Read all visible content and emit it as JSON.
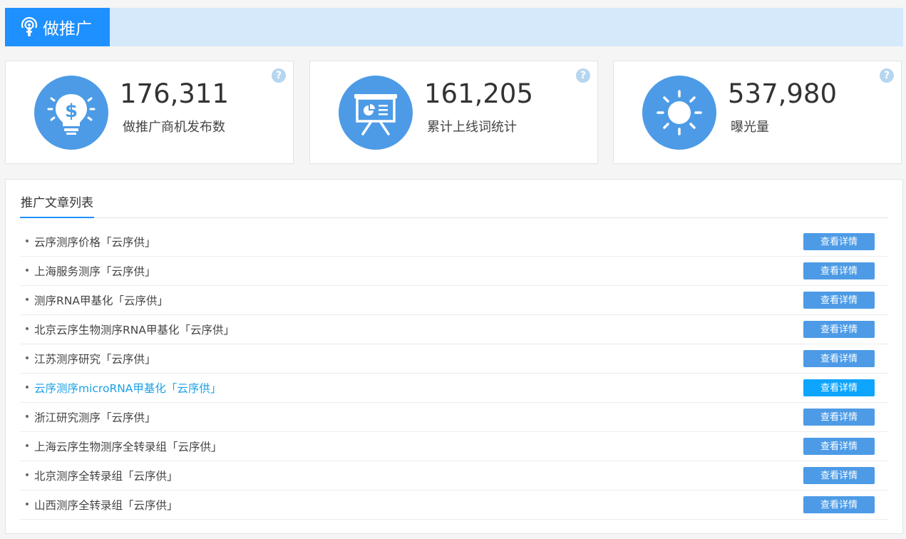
{
  "header": {
    "title": "做推广"
  },
  "stats": [
    {
      "value": "176,311",
      "label": "做推广商机发布数",
      "icon": "money-bulb-icon"
    },
    {
      "value": "161,205",
      "label": "累计上线词统计",
      "icon": "presentation-board-icon"
    },
    {
      "value": "537,980",
      "label": "曝光量",
      "icon": "sun-icon"
    }
  ],
  "help_glyph": "?",
  "list": {
    "tab_label": "推广文章列表",
    "button_label": "查看详情",
    "highlight_color": "#1aa0e6",
    "items": [
      "云序测序价格「云序供」",
      "上海服务测序「云序供」",
      "测序RNA甲基化「云序供」",
      "北京云序生物测序RNA甲基化「云序供」",
      "江苏测序研究「云序供」",
      "云序测序microRNA甲基化「云序供」",
      "浙江研究测序「云序供」",
      "上海云序生物测序全转录组「云序供」",
      "北京测序全转录组「云序供」",
      "山西测序全转录组「云序供」"
    ],
    "highlighted_index": 5
  },
  "colors": {
    "accent": "#1e90ff",
    "button": "#4d9be6",
    "header_bg": "#d6e9fb"
  }
}
